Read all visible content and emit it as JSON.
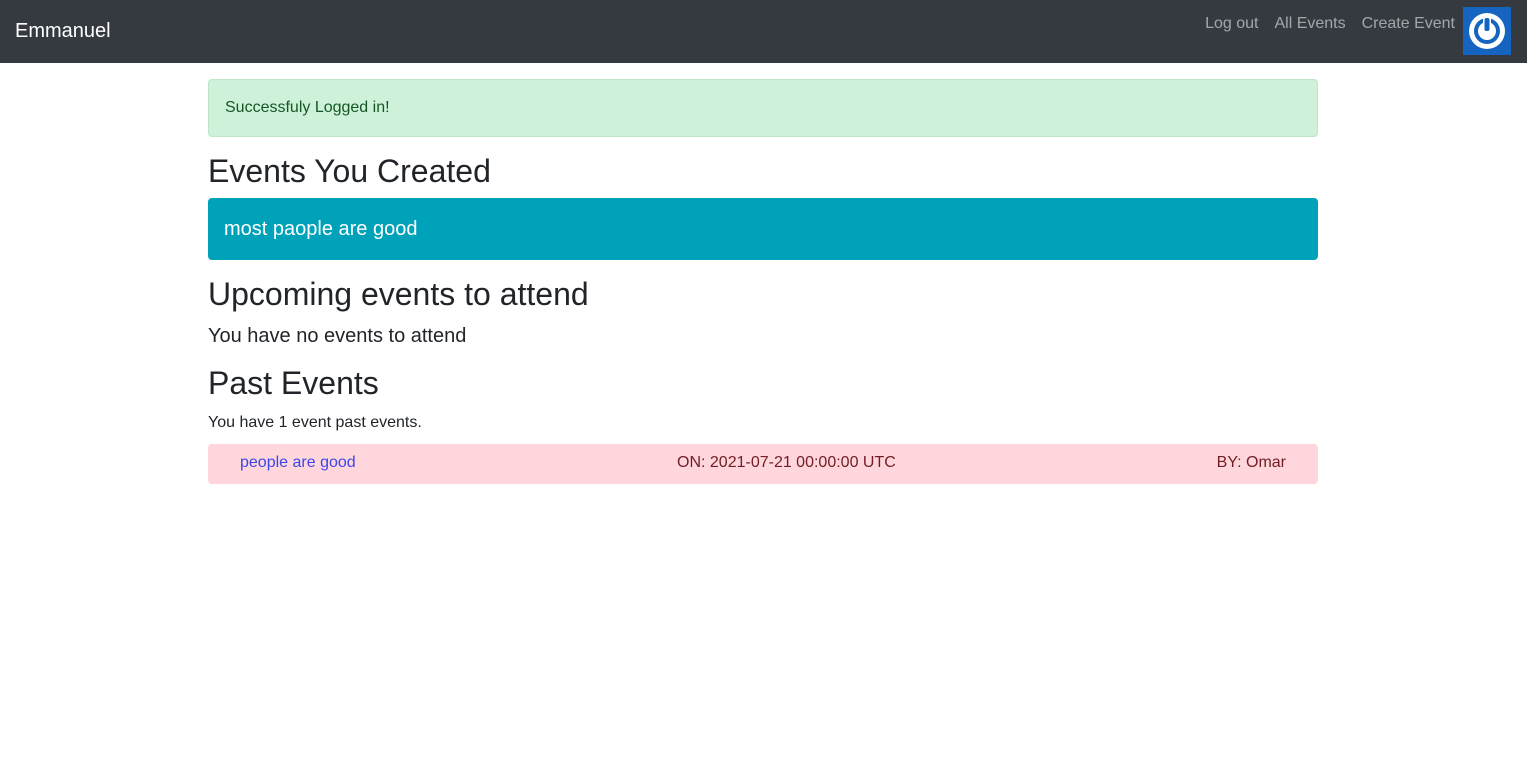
{
  "navbar": {
    "brand": "Emmanuel",
    "links": [
      {
        "label": "Log out"
      },
      {
        "label": "All Events"
      },
      {
        "label": "Create Event"
      }
    ],
    "avatar_icon": "power-icon"
  },
  "alert": {
    "message": "Successfuly Logged in!"
  },
  "created": {
    "heading": "Events You Created",
    "events": [
      {
        "title": "most paople are good"
      }
    ]
  },
  "upcoming": {
    "heading": "Upcoming events to attend",
    "empty_message": "You have no events to attend"
  },
  "past": {
    "heading": "Past Events",
    "summary": "You have 1 event past events.",
    "events": [
      {
        "title": "people are good",
        "date": "ON: 2021-07-21 00:00:00 UTC",
        "by": "BY: Omar"
      }
    ]
  },
  "colors": {
    "navbar_bg": "#343a40",
    "success_bg": "#cdf1d9",
    "info_bg": "#00a2b9",
    "danger_bg": "#fed6dc",
    "link": "#3d47e8"
  }
}
